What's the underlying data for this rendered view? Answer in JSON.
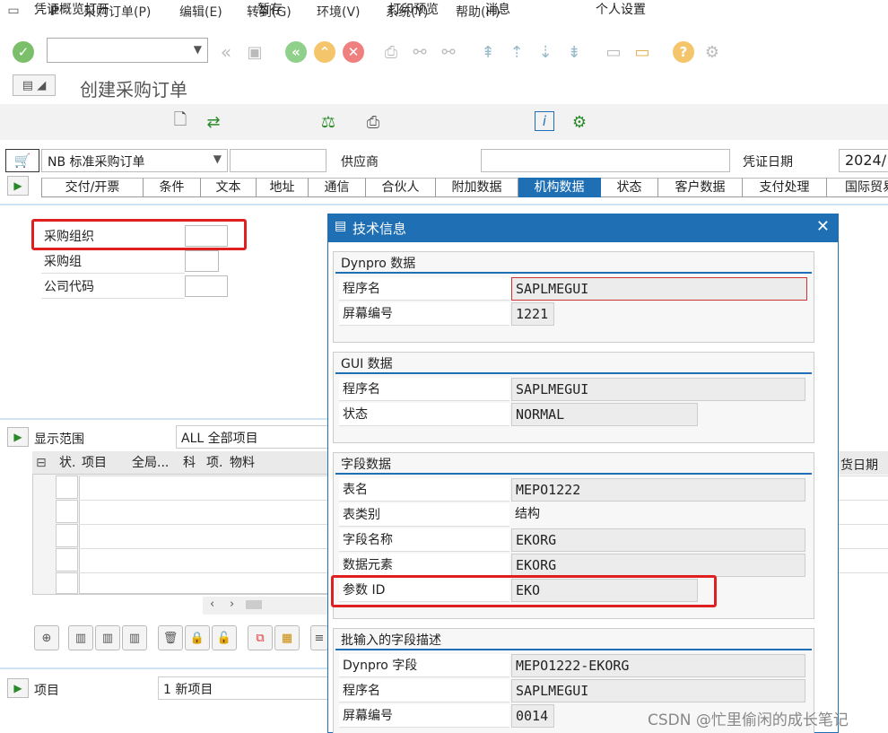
{
  "menu": [
    "采购订单(P)",
    "编辑(E)",
    "转到(G)",
    "环境(V)",
    "系统(Y)",
    "帮助(H)"
  ],
  "window_title": "创建采购订单",
  "app_toolbar": {
    "overview": "凭证概览打开",
    "hold": "暂存",
    "print_preview": "打印预览",
    "messages": "消息",
    "personal_settings": "个人设置"
  },
  "header": {
    "order_type": "NB 标准采购订单",
    "vendor_label": "供应商",
    "doc_date_label": "凭证日期",
    "doc_date_value": "2024/"
  },
  "tabs": [
    "交付/开票",
    "条件",
    "文本",
    "地址",
    "通信",
    "合伙人",
    "附加数据",
    "机构数据",
    "状态",
    "客户数据",
    "支付处理",
    "国际贸易"
  ],
  "active_tab": "机构数据",
  "org_fields": [
    "采购组织",
    "采购组",
    "公司代码"
  ],
  "items": {
    "scope_label": "显示范围",
    "scope_value": "ALL 全部项目",
    "columns": [
      "状.",
      "项目",
      "全局...",
      "科",
      "项.",
      "物料"
    ],
    "right_col": "货日期",
    "item_label": "项目",
    "item_value": "1 新项目"
  },
  "dialog": {
    "title": "技术信息",
    "dynpro": {
      "header": "Dynpro 数据",
      "rows": [
        {
          "label": "程序名",
          "value": "SAPLMEGUI"
        },
        {
          "label": "屏幕编号",
          "value": "1221"
        }
      ]
    },
    "gui": {
      "header": "GUI 数据",
      "rows": [
        {
          "label": "程序名",
          "value": "SAPLMEGUI"
        },
        {
          "label": "状态",
          "value": "NORMAL"
        }
      ]
    },
    "field": {
      "header": "字段数据",
      "rows": [
        {
          "label": "表名",
          "value": "MEPO1222"
        },
        {
          "label": "表类别",
          "value": "结构"
        },
        {
          "label": "字段名称",
          "value": "EKORG"
        },
        {
          "label": "数据元素",
          "value": "EKORG"
        },
        {
          "label": "参数 ID",
          "value": "EKO"
        }
      ]
    },
    "batch": {
      "header": "批输入的字段描述",
      "rows": [
        {
          "label": "Dynpro 字段",
          "value": "MEPO1222-EKORG"
        },
        {
          "label": "程序名",
          "value": "SAPLMEGUI"
        },
        {
          "label": "屏幕编号",
          "value": "0014"
        }
      ]
    }
  },
  "watermark": "CSDN @忙里偷闲的成长笔记"
}
